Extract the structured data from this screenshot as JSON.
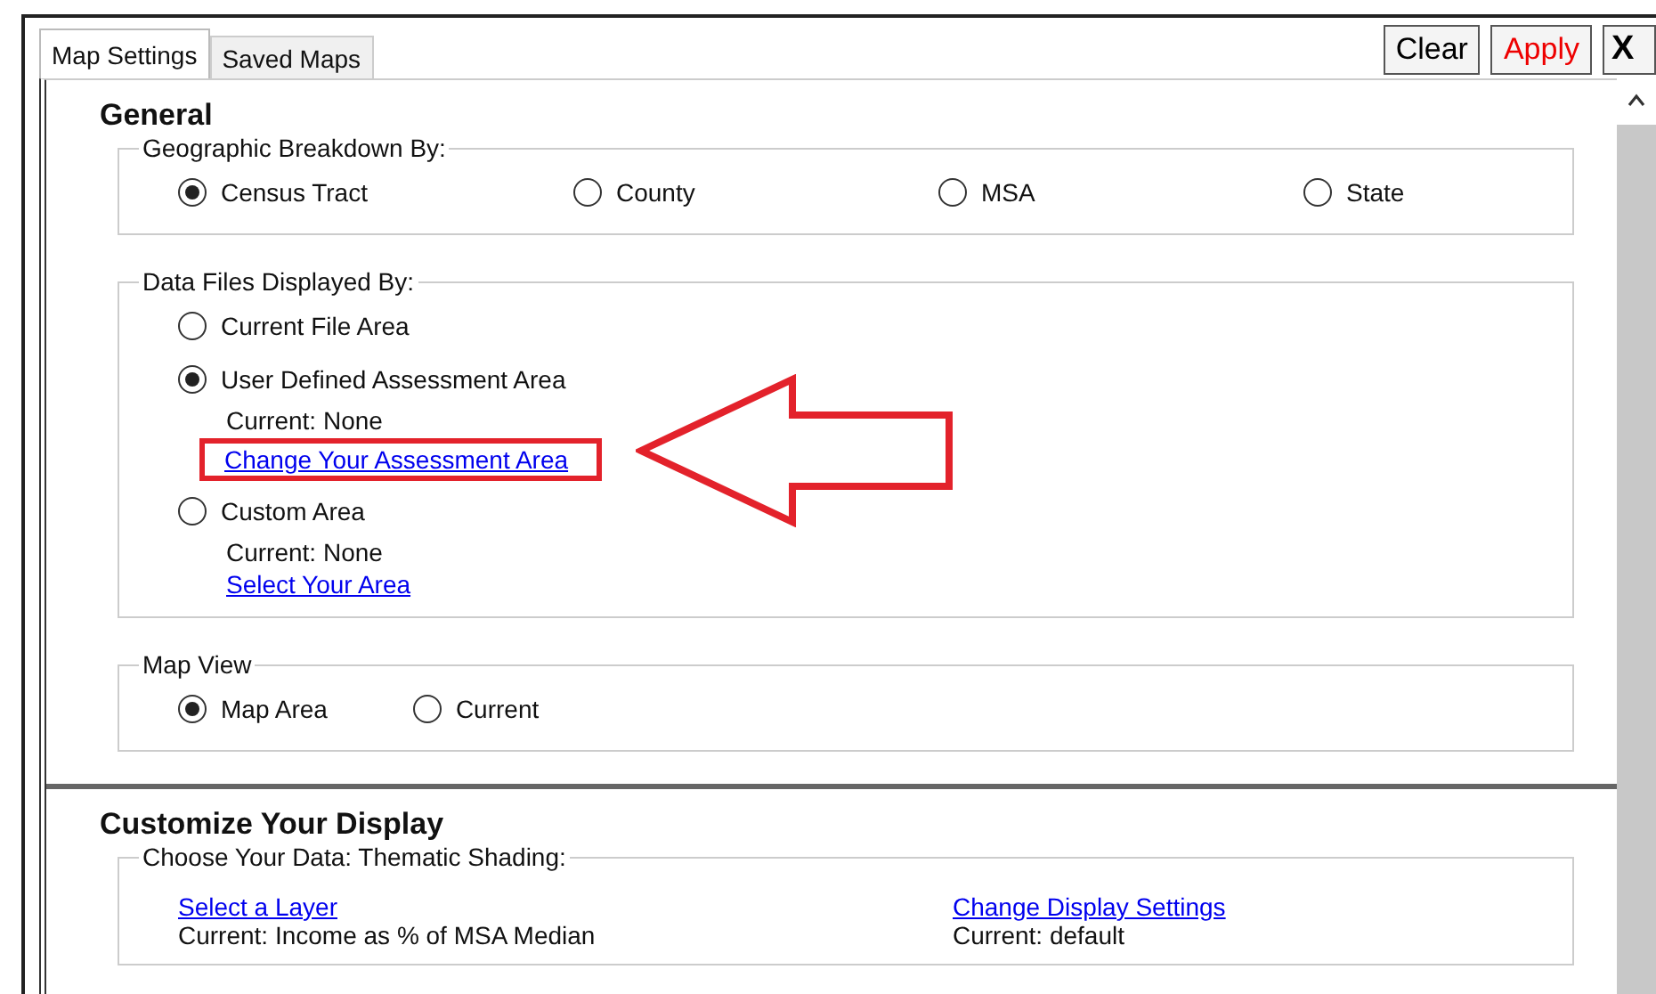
{
  "tabs": [
    {
      "label": "Map Settings",
      "selected": true
    },
    {
      "label": "Saved Maps",
      "selected": false
    }
  ],
  "buttons": [
    {
      "label": "Clear",
      "kind": "normal"
    },
    {
      "label": "Apply",
      "kind": "accent"
    },
    {
      "label": "X",
      "kind": "close"
    }
  ],
  "general": {
    "title": "General",
    "geographic_breakdown": {
      "label": "Geographic Breakdown By:",
      "options": [
        {
          "label": "Census Tract",
          "selected": true
        },
        {
          "label": "County",
          "selected": false
        },
        {
          "label": "MSA",
          "selected": false
        },
        {
          "label": "State",
          "selected": false
        }
      ]
    },
    "data_files": {
      "label": "Data Files Displayed By:",
      "options": [
        {
          "label": "Current File Area",
          "selected": false
        },
        {
          "label": "User Defined Assessment Area",
          "selected": true,
          "current": "Current: None",
          "link": "Change Your Assessment Area",
          "highlighted": true
        },
        {
          "label": "Custom Area",
          "selected": false,
          "current": "Current: None",
          "link": "Select Your Area",
          "highlighted": false
        }
      ]
    },
    "map_view": {
      "label": "Map View",
      "options": [
        {
          "label": "Map Area",
          "selected": true
        },
        {
          "label": "Current",
          "selected": false
        }
      ]
    }
  },
  "customize": {
    "title": "Customize Your Display",
    "thematic_shading": {
      "label": "Choose Your Data: Thematic Shading:",
      "items": [
        {
          "link": "Select a Layer",
          "current": "Current: Income as % of MSA Median"
        },
        {
          "link": "Change Display Settings",
          "current": "Current: default"
        }
      ]
    }
  }
}
